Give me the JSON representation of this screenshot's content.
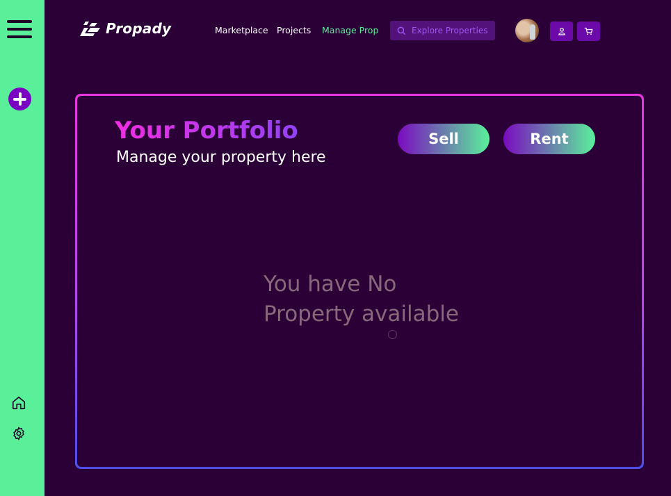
{
  "brand": {
    "name": "Propady"
  },
  "nav": {
    "marketplace": "Marketplace",
    "projects": "Projects",
    "manage": "Manage Prop"
  },
  "search": {
    "placeholder": "Explore Properties"
  },
  "portfolio": {
    "title": "Your Portfolio",
    "subtitle": "Manage your property here",
    "sell_label": "Sell",
    "rent_label": "Rent",
    "empty_line1": "You have No",
    "empty_line2": "Property available"
  },
  "colors": {
    "background": "#2b0037",
    "sidebar": "#5af09a",
    "accent_green": "#5af09a",
    "accent_purple": "#7a0bbf",
    "border_top": "#e936e0",
    "border_bottom": "#4c4ee6"
  },
  "icons": {
    "sidebar": [
      "menu-icon",
      "plus-icon",
      "home-icon",
      "settings-icon"
    ],
    "header": [
      "search-icon",
      "user-icon",
      "cart-icon"
    ]
  }
}
